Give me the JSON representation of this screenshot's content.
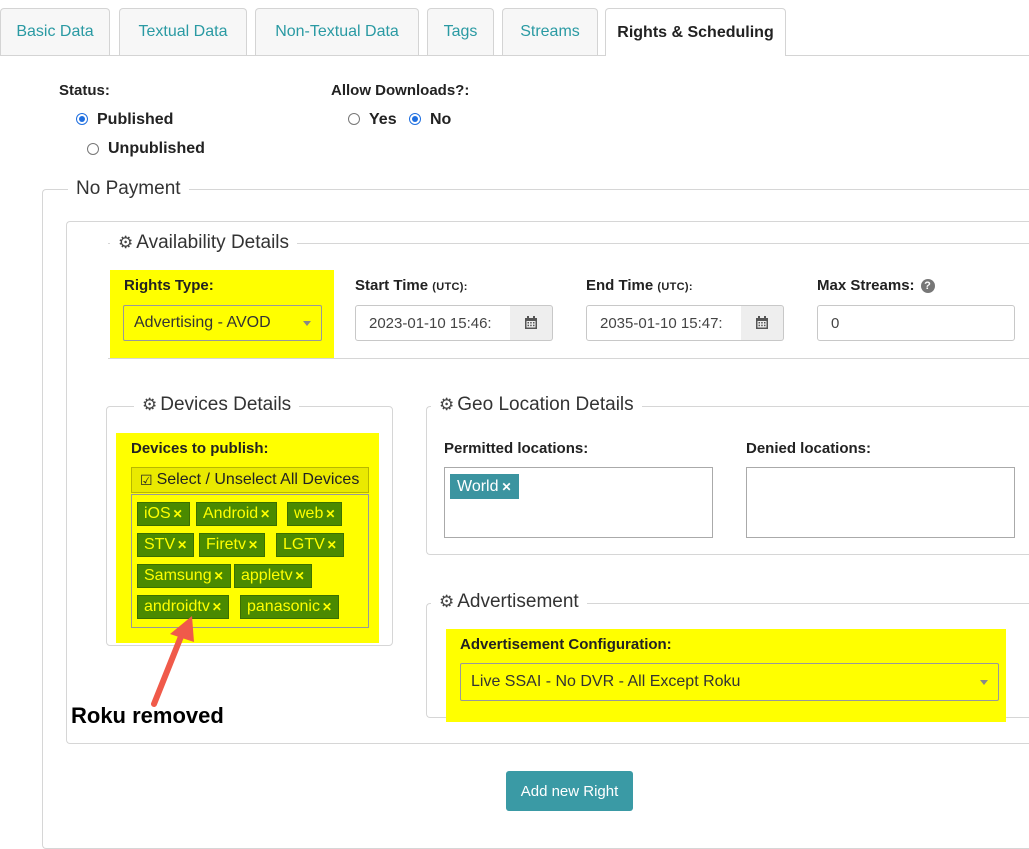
{
  "tabs": [
    {
      "label": "Basic Data"
    },
    {
      "label": "Textual Data"
    },
    {
      "label": "Non-Textual Data"
    },
    {
      "label": "Tags"
    },
    {
      "label": "Streams"
    },
    {
      "label": "Rights & Scheduling",
      "active": true
    }
  ],
  "status": {
    "label": "Status:",
    "options": [
      "Published",
      "Unpublished"
    ],
    "selected": "Published"
  },
  "downloads": {
    "label": "Allow Downloads?:",
    "options": [
      "Yes",
      "No"
    ],
    "selected": "No"
  },
  "payment": {
    "legend": "No Payment"
  },
  "availability": {
    "legend": "Availability Details",
    "rights_type_label": "Rights Type:",
    "rights_type_value": "Advertising - AVOD",
    "start_label": "Start Time",
    "start_unit": "(UTC):",
    "start_value": "2023-01-10 15:46:",
    "end_label": "End Time",
    "end_unit": "(UTC):",
    "end_value": "2035-01-10 15:47:",
    "max_streams_label": "Max Streams:",
    "max_streams_value": "0"
  },
  "devices": {
    "legend": "Devices Details",
    "label": "Devices to publish:",
    "select_all": "Select / Unselect All Devices",
    "chips": [
      "iOS",
      "Android",
      "web",
      "STV",
      "Firetv",
      "LGTV",
      "Samsung",
      "appletv",
      "androidtv",
      "panasonic"
    ]
  },
  "geo": {
    "legend": "Geo Location Details",
    "permitted_label": "Permitted locations:",
    "permitted": [
      "World"
    ],
    "denied_label": "Denied locations:"
  },
  "advertisement": {
    "legend": "Advertisement",
    "label": "Advertisement Configuration:",
    "value": "Live SSAI - No DVR - All Except Roku"
  },
  "annotation": {
    "text": "Roku removed"
  },
  "add_button": "Add new Right",
  "colors": {
    "accent": "#3a9aa5",
    "highlight": "#ffff00",
    "chip": "#4a8a00",
    "radio": "#1f6fe0",
    "arrow": "#f05a4a"
  }
}
